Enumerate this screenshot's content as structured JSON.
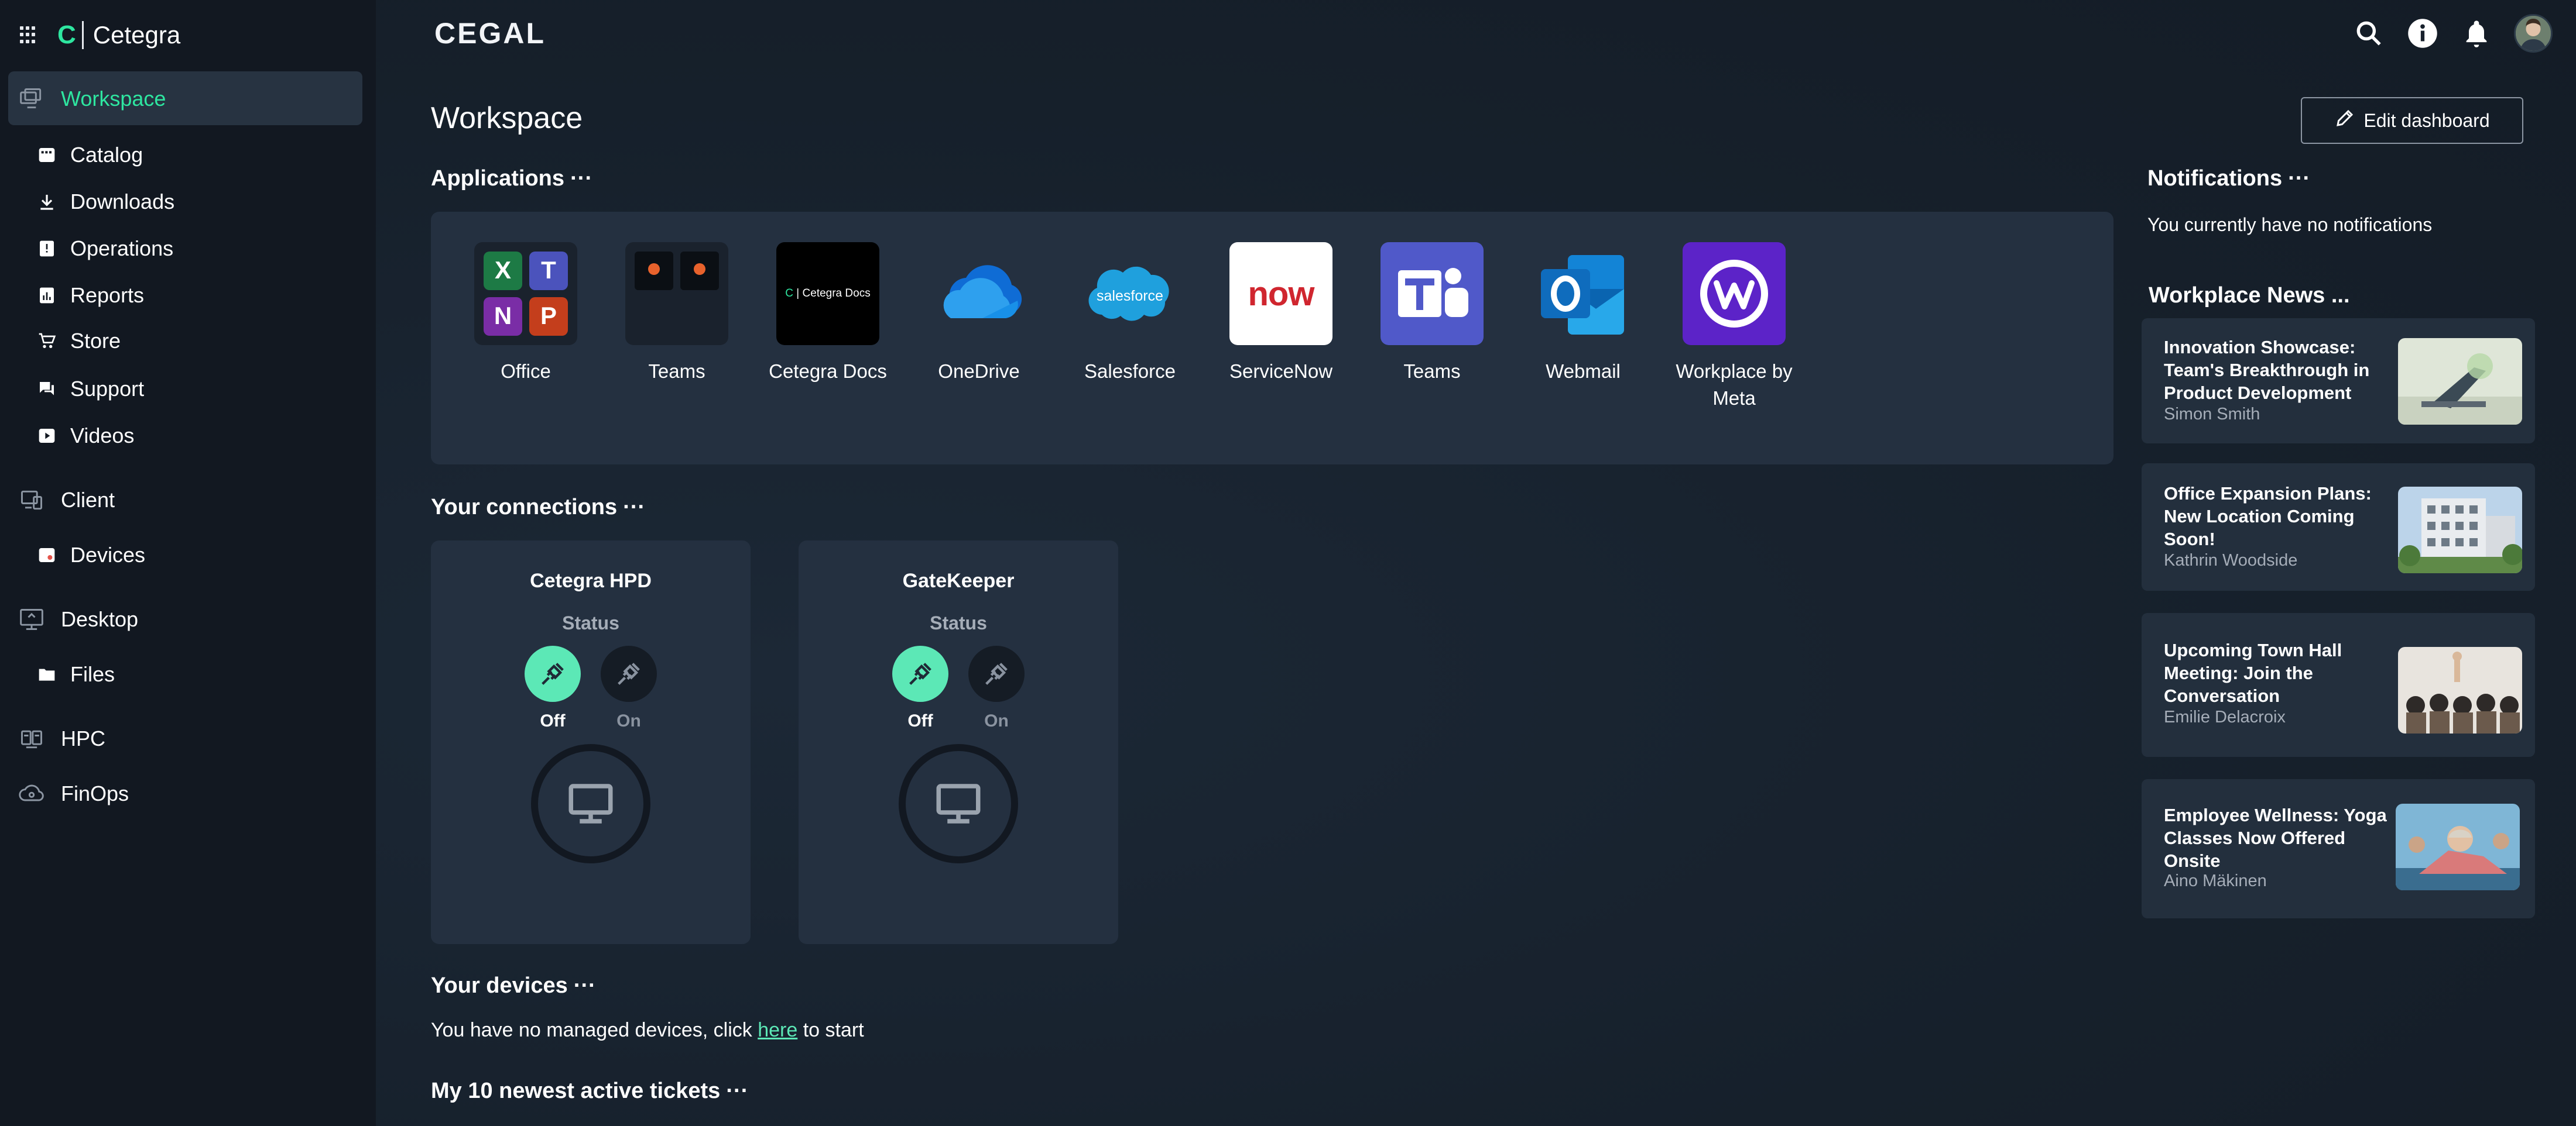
{
  "sidebar": {
    "brand_letter": "C",
    "brand_name": "Cetegra",
    "items": [
      {
        "label": "Workspace",
        "icon": "workspace-icon"
      },
      {
        "label": "Catalog",
        "icon": "catalog-icon"
      },
      {
        "label": "Downloads",
        "icon": "download-icon"
      },
      {
        "label": "Operations",
        "icon": "operations-icon"
      },
      {
        "label": "Reports",
        "icon": "reports-icon"
      },
      {
        "label": "Store",
        "icon": "cart-icon"
      },
      {
        "label": "Support",
        "icon": "support-icon"
      },
      {
        "label": "Videos",
        "icon": "video-icon"
      },
      {
        "label": "Client",
        "icon": "client-icon"
      },
      {
        "label": "Devices",
        "icon": "devices-icon"
      },
      {
        "label": "Desktop",
        "icon": "desktop-icon"
      },
      {
        "label": "Files",
        "icon": "folder-icon"
      },
      {
        "label": "HPC",
        "icon": "hpc-icon"
      },
      {
        "label": "FinOps",
        "icon": "finops-icon"
      }
    ]
  },
  "header": {
    "logo": "CEGAL"
  },
  "main": {
    "title": "Workspace",
    "edit_label": "Edit dashboard",
    "applications_title": "Applications",
    "apps": [
      {
        "label": "Office"
      },
      {
        "label": "Teams"
      },
      {
        "label": "Cetegra Docs",
        "tile_text": "Cetegra Docs"
      },
      {
        "label": "OneDrive"
      },
      {
        "label": "Salesforce",
        "tile_text": "salesforce"
      },
      {
        "label": "ServiceNow",
        "tile_text": "now"
      },
      {
        "label": "Teams"
      },
      {
        "label": "Webmail"
      },
      {
        "label": "Workplace by Meta"
      }
    ],
    "connections_title": "Your connections",
    "connections": [
      {
        "name": "Cetegra HPD",
        "status_label": "Status",
        "off_label": "Off",
        "on_label": "On"
      },
      {
        "name": "GateKeeper",
        "status_label": "Status",
        "off_label": "Off",
        "on_label": "On"
      }
    ],
    "devices_title": "Your devices",
    "devices_text_before": "You have no managed devices, click",
    "devices_link": "here",
    "devices_text_after": "to start",
    "tickets_title": "My 10 newest active tickets"
  },
  "right": {
    "notifications_title": "Notifications",
    "notifications_text": "You currently have no notifications",
    "news_title": "Workplace News ...",
    "news": [
      {
        "title": "Innovation Showcase: Team's Breakthrough in Product Development",
        "author": "Simon Smith"
      },
      {
        "title": "Office Expansion Plans: New Location Coming Soon!",
        "author": "Kathrin Woodside"
      },
      {
        "title": "Upcoming Town Hall Meeting: Join the Conversation",
        "author": "Emilie Delacroix"
      },
      {
        "title": "Employee Wellness: Yoga Classes Now Offered Onsite",
        "author": "Aino Mäkinen"
      }
    ]
  },
  "colors": {
    "accent": "#2ee6a0",
    "toggle_off": "#5ce8b6",
    "panel": "#243040",
    "sidebar": "#121821"
  }
}
